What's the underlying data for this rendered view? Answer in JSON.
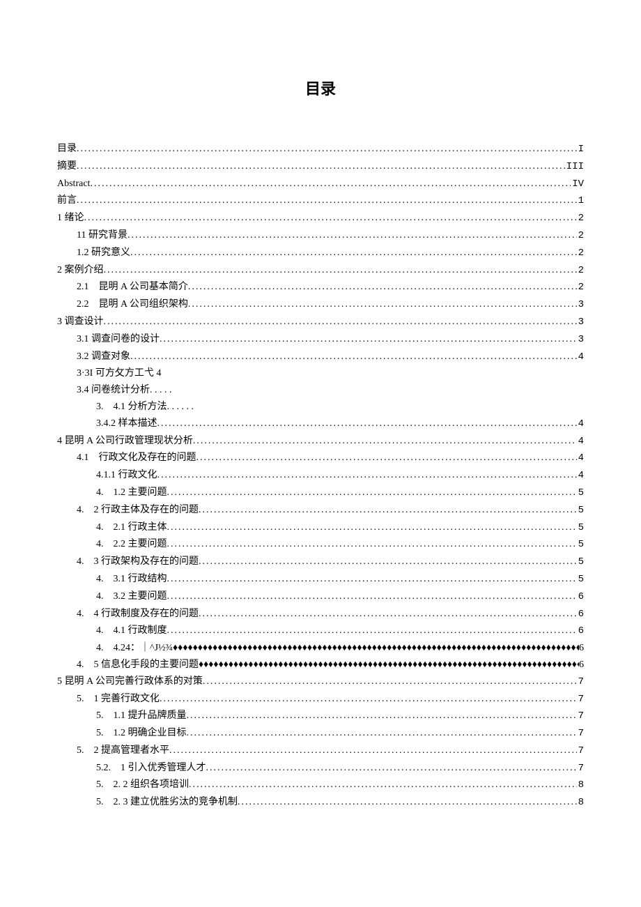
{
  "title": "目录",
  "entries": [
    {
      "level": 0,
      "label": "目录",
      "leader": "dots",
      "page": "I"
    },
    {
      "level": 0,
      "label": "摘要",
      "leader": "dots",
      "page": "III"
    },
    {
      "level": 0,
      "label": "Abstract",
      "leader": "dots",
      "page": "IV"
    },
    {
      "level": 0,
      "label": "前言",
      "leader": "dots",
      "page": "1"
    },
    {
      "level": 0,
      "label": "1 绪论",
      "leader": "dots",
      "page": "2"
    },
    {
      "level": 1,
      "label": "11 研究背景",
      "leader": "dots",
      "page": "2"
    },
    {
      "level": 1,
      "label": "1.2 研究意义",
      "leader": "dots",
      "page": "2"
    },
    {
      "level": 0,
      "label": "2 案例介绍",
      "leader": "dots",
      "page": "2"
    },
    {
      "level": 1,
      "label": "2.1　昆明 A 公司基本简介",
      "leader": "dots",
      "page": "2"
    },
    {
      "level": 1,
      "label": "2.2　昆明 A 公司组织架构",
      "leader": "dots",
      "page": "3"
    },
    {
      "level": 0,
      "label": "3 调查设计",
      "leader": "dots",
      "page": "3"
    },
    {
      "level": 1,
      "label": "3.1 调查问卷的设计",
      "leader": "dots",
      "page": "3"
    },
    {
      "level": 1,
      "label": "3.2 调查对象",
      "leader": "dots",
      "page": "4"
    },
    {
      "level": 1,
      "label": "3·3I 可方攵方工弋 4",
      "leader": "none",
      "page": ""
    },
    {
      "level": 1,
      "label": "3.4 问卷统计分析",
      "leader": "trail1",
      "page": ""
    },
    {
      "level": 2,
      "label": "3.　4.1 分析方法",
      "leader": "trail2",
      "page": ""
    },
    {
      "level": 2,
      "label": "3.4.2 样本描述",
      "leader": "dots",
      "page": "4"
    },
    {
      "level": 0,
      "label": "4 昆明 A 公司行政管理现状分析",
      "leader": "dots",
      "page": "4"
    },
    {
      "level": 1,
      "label": "4.1　行政文化及存在的问题",
      "leader": "dots",
      "page": "4"
    },
    {
      "level": 2,
      "label": "4.1.1 行政文化",
      "leader": "dots",
      "page": "4"
    },
    {
      "level": 2,
      "label": "4.　1.2 主要问题",
      "leader": "dots",
      "page": "5"
    },
    {
      "level": 1,
      "label": "4.　2 行政主体及存在的问题",
      "leader": "dots",
      "page": "5"
    },
    {
      "level": 2,
      "label": "4.　2.1 行政主体",
      "leader": "dots",
      "page": "5"
    },
    {
      "level": 2,
      "label": "4.　2.2 主要问题",
      "leader": "dots",
      "page": "5"
    },
    {
      "level": 1,
      "label": "4.　3 行政架构及存在的问题",
      "leader": "dots",
      "page": "5"
    },
    {
      "level": 2,
      "label": "4.　3.1 行政结构",
      "leader": "dots",
      "page": "5"
    },
    {
      "level": 2,
      "label": "4.　3.2 主要问题",
      "leader": "dots",
      "page": "6"
    },
    {
      "level": 1,
      "label": "4.　4 行政制度及存在的问题",
      "leader": "dots",
      "page": "6"
    },
    {
      "level": 2,
      "label": "4.　4.1 行政制度",
      "leader": "dots",
      "page": "6"
    },
    {
      "level": 2,
      "label": "4.　4.24：｜^J½¾",
      "leader": "diamonds",
      "page": "6"
    },
    {
      "level": 1,
      "label": "4.　5 信息化手段的主要问题",
      "leader": "diamonds",
      "page": "6"
    },
    {
      "level": 0,
      "label": "5 昆明 A 公司完善行政体系的对策",
      "leader": "dots",
      "page": "7"
    },
    {
      "level": 1,
      "label": "5.　1 完善行政文化",
      "leader": "dots",
      "page": "7"
    },
    {
      "level": 2,
      "label": "5.　1.1 提升品牌质量",
      "leader": "dots",
      "page": "7"
    },
    {
      "level": 2,
      "label": "5.　1.2 明确企业目标",
      "leader": "dots",
      "page": "7"
    },
    {
      "level": 1,
      "label": "5.　2 提高管理者水平",
      "leader": "dots",
      "page": "7"
    },
    {
      "level": 2,
      "label": "5.2.　1 引入优秀管理人才",
      "leader": "dots",
      "page": "7"
    },
    {
      "level": 2,
      "label": "5.　2. 2 组织各项培训",
      "leader": "dots",
      "page": "8"
    },
    {
      "level": 2,
      "label": "5.　2. 3 建立优胜劣汰的竞争机制",
      "leader": "dots",
      "page": "8"
    }
  ]
}
